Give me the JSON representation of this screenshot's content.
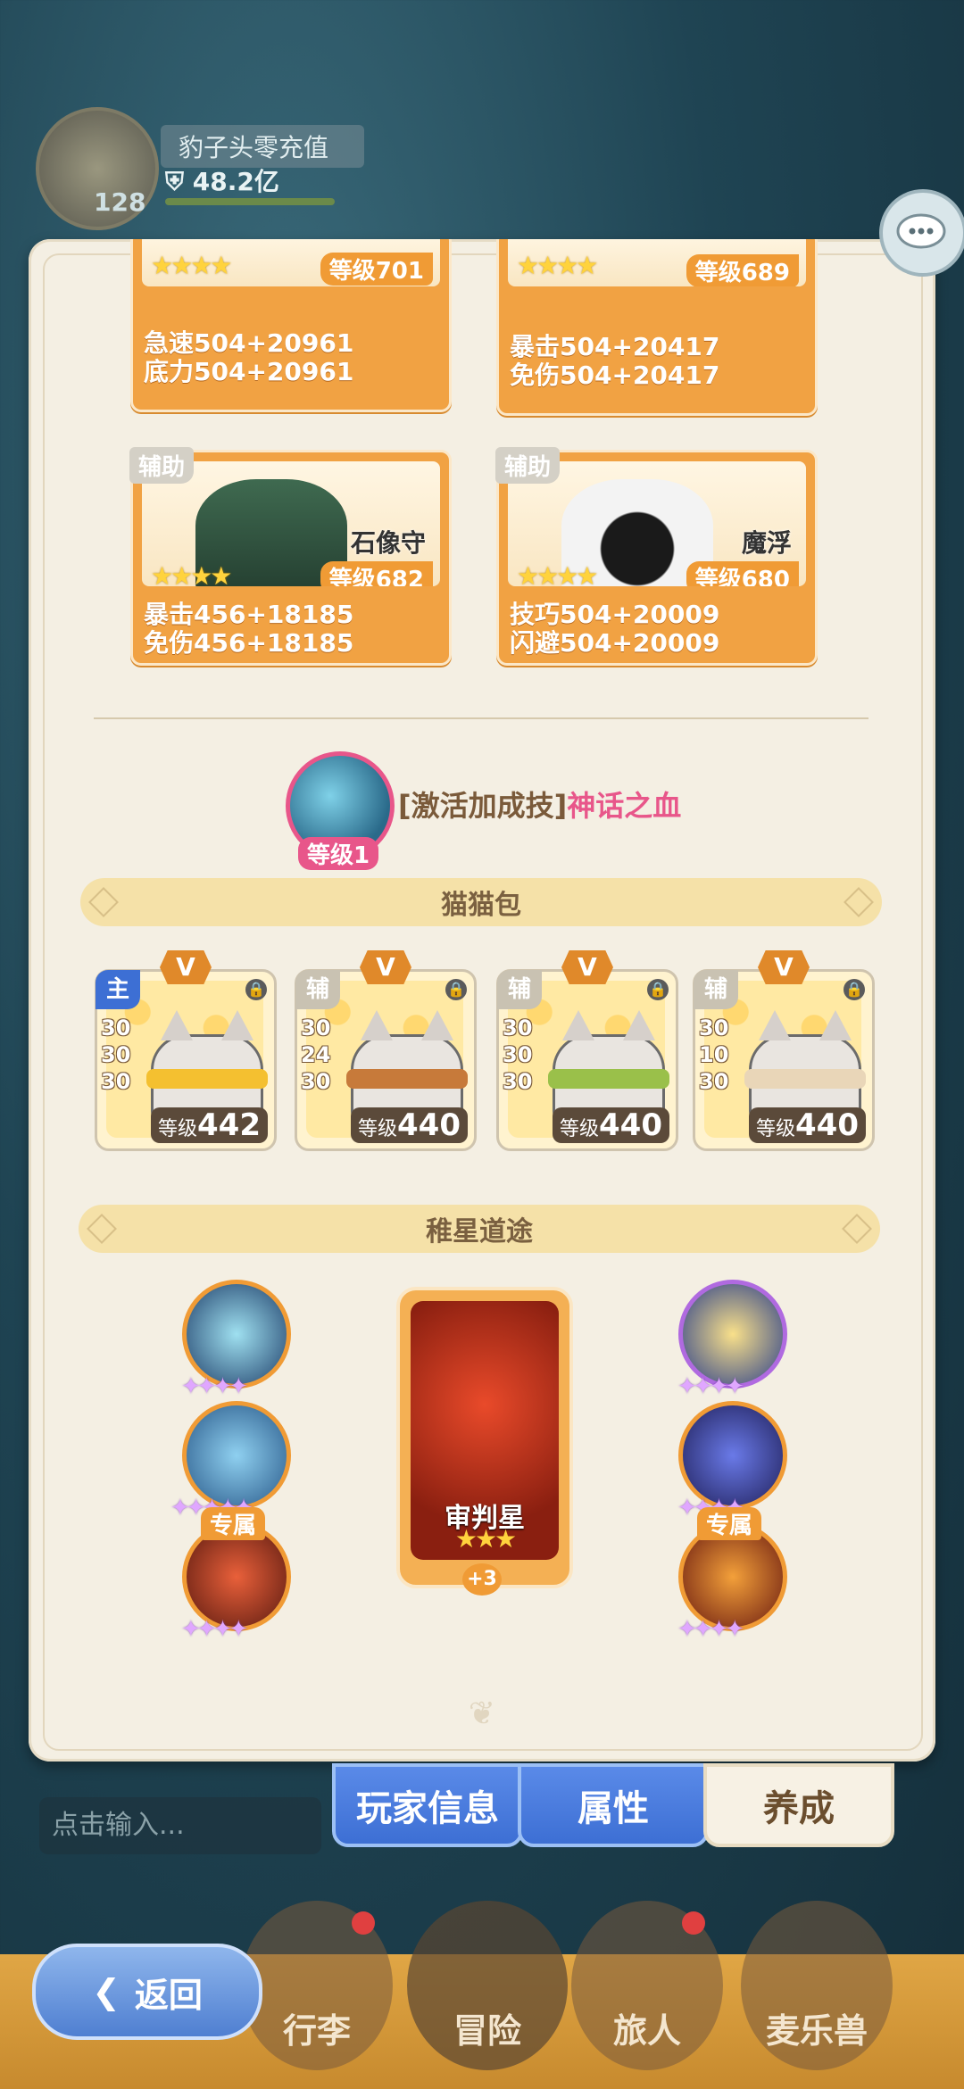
{
  "profile": {
    "name": "豹子头零充值",
    "power": "48.2亿",
    "level": "128"
  },
  "partners": [
    {
      "role": "",
      "name": "",
      "level": "等级701",
      "stats": [
        "急速504+20961",
        "底力504+20961"
      ]
    },
    {
      "role": "",
      "name": "",
      "level": "等级689",
      "stats": [
        "暴击504+20417",
        "免伤504+20417"
      ]
    },
    {
      "role": "辅助",
      "name": "石像守",
      "level": "等级682",
      "stats": [
        "暴击456+18185",
        "免伤456+18185"
      ]
    },
    {
      "role": "辅助",
      "name": "魔浮",
      "level": "等级680",
      "stats": [
        "技巧504+20009",
        "闪避504+20009"
      ]
    }
  ],
  "bonus_skill": {
    "prefix": "[激活加成技]",
    "name": "神话之血",
    "level": "等级1"
  },
  "cat_bag": {
    "title": "猫猫包",
    "bags": [
      {
        "role": "主",
        "v": "V",
        "nums": [
          "30",
          "30",
          "30"
        ],
        "level_prefix": "等级",
        "level": "442"
      },
      {
        "role": "辅",
        "v": "V",
        "nums": [
          "30",
          "24",
          "30"
        ],
        "level_prefix": "等级",
        "level": "440"
      },
      {
        "role": "辅",
        "v": "V",
        "nums": [
          "30",
          "30",
          "30"
        ],
        "level_prefix": "等级",
        "level": "440"
      },
      {
        "role": "辅",
        "v": "V",
        "nums": [
          "30",
          "10",
          "30"
        ],
        "level_prefix": "等级",
        "level": "440"
      }
    ]
  },
  "star_path": {
    "title": "稚星道途",
    "exclusive_label": "专属",
    "center": {
      "name": "审判星",
      "plus": "+3"
    }
  },
  "tabs": {
    "info": "玩家信息",
    "attr": "属性",
    "grow": "养成"
  },
  "chat": {
    "placeholder": "点击输入..."
  },
  "nav": {
    "back": "返回",
    "items": [
      "行李",
      "冒险",
      "旅人",
      "麦乐兽"
    ]
  },
  "colors": {
    "accent": "#f09b35",
    "pink": "#e8568a",
    "tab_blue": "#4f7fd1"
  }
}
